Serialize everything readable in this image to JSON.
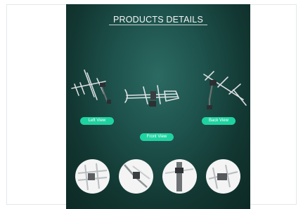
{
  "header": {
    "title": "PRODUCTS DETAILS"
  },
  "views": {
    "left": "Left View",
    "back": "Back View",
    "front": "Front View"
  },
  "colors": {
    "panel_bg": "#1a4a44",
    "accent": "#1fd3a1"
  }
}
